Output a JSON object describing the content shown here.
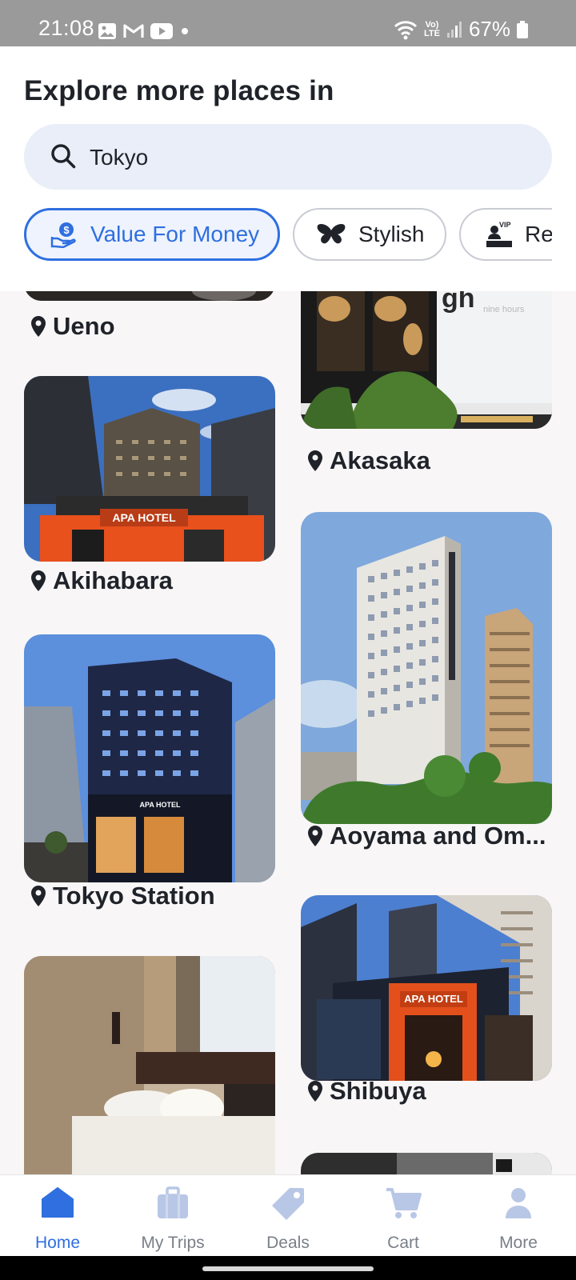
{
  "status_bar": {
    "time": "21:08",
    "battery": "67%",
    "lte_line1": "Vo)",
    "lte_line2": "LTE"
  },
  "header": {
    "title": "Explore more places in",
    "search": {
      "value": "Tokyo",
      "icon": "search-icon"
    }
  },
  "chips": [
    {
      "label": "Value For Money",
      "icon": "money-hand-icon",
      "active": true
    },
    {
      "label": "Stylish",
      "icon": "butterfly-icon",
      "active": false
    },
    {
      "label": "Re",
      "icon": "vip-icon",
      "active": false
    }
  ],
  "places": {
    "left": [
      "Ueno",
      "Akihabara",
      "Tokyo Station"
    ],
    "right": [
      "Akasaka",
      "Aoyama and Om...",
      "Shibuya"
    ]
  },
  "nav": [
    {
      "label": "Home",
      "icon": "home-icon",
      "active": true
    },
    {
      "label": "My Trips",
      "icon": "suitcase-icon",
      "active": false
    },
    {
      "label": "Deals",
      "icon": "tag-icon",
      "active": false
    },
    {
      "label": "Cart",
      "icon": "cart-icon",
      "active": false
    },
    {
      "label": "More",
      "icon": "person-icon",
      "active": false
    }
  ],
  "colors": {
    "accent": "#2f6fe0",
    "nav_inactive_icon": "#b9c7e6",
    "search_bg": "#e9eef8"
  }
}
